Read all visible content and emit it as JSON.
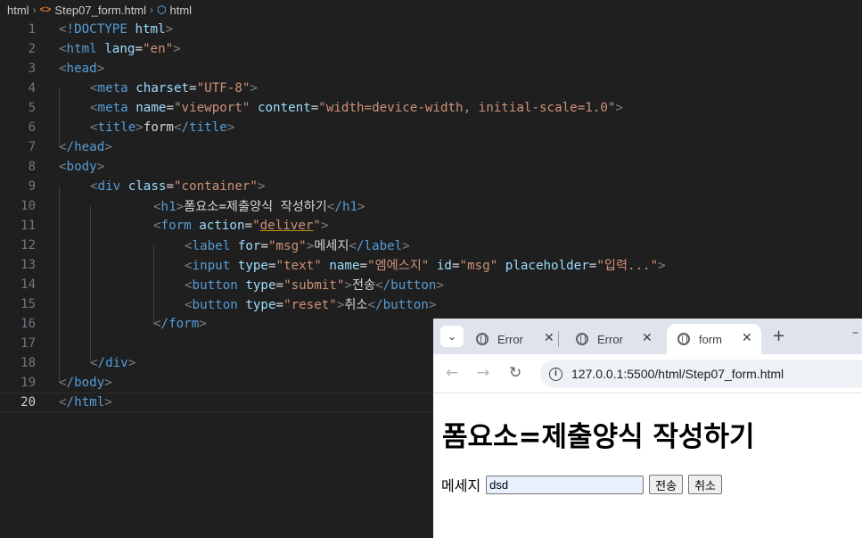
{
  "breadcrumb": {
    "root": "html",
    "file": "Step07_form.html",
    "element": "html"
  },
  "editor": {
    "current_line": 20,
    "lines": [
      {
        "n": "1"
      },
      {
        "n": "2"
      },
      {
        "n": "3"
      },
      {
        "n": "4"
      },
      {
        "n": "5"
      },
      {
        "n": "6"
      },
      {
        "n": "7"
      },
      {
        "n": "8"
      },
      {
        "n": "9"
      },
      {
        "n": "10"
      },
      {
        "n": "11"
      },
      {
        "n": "12"
      },
      {
        "n": "13"
      },
      {
        "n": "14"
      },
      {
        "n": "15"
      },
      {
        "n": "16"
      },
      {
        "n": "17"
      },
      {
        "n": "18"
      },
      {
        "n": "19"
      },
      {
        "n": "20"
      }
    ],
    "code": {
      "doctype_kw": "!DOCTYPE",
      "doctype_val": "html",
      "html_tag": "html",
      "lang_attr": "lang",
      "lang_val": "\"en\"",
      "head_tag": "head",
      "meta_tag": "meta",
      "charset_attr": "charset",
      "charset_val": "\"UTF-8\"",
      "name_attr": "name",
      "viewport_val": "\"viewport\"",
      "content_attr": "content",
      "content_val": "\"width=device-width, initial-scale=1.0\"",
      "title_tag": "title",
      "title_text": "form",
      "title_close": "/title",
      "head_close": "/head",
      "body_tag": "body",
      "div_tag": "div",
      "class_attr": "class",
      "class_val": "\"container\"",
      "h1_tag": "h1",
      "h1_text": "폼요소=제출양식 작성하기",
      "h1_close": "/h1",
      "form_tag": "form",
      "action_attr": "action",
      "action_q1": "\"",
      "action_val": "deliver",
      "action_q2": "\"",
      "label_tag": "label",
      "for_attr": "for",
      "for_val": "\"msg\"",
      "label_text": "메세지",
      "label_close": "/label",
      "input_tag": "input",
      "type_attr": "type",
      "text_val": "\"text\"",
      "input_name_val": "\"엠에스지\"",
      "id_attr": "id",
      "id_val": "\"msg\"",
      "placeholder_attr": "placeholder",
      "placeholder_val": "\"입력...\"",
      "button_tag": "button",
      "submit_val": "\"submit\"",
      "submit_text": "전송",
      "button_close": "/button",
      "reset_val": "\"reset\"",
      "reset_text": "취소",
      "form_close": "/form",
      "div_close": "/div",
      "body_close": "/body",
      "html_close": "/html"
    }
  },
  "browser": {
    "tabs": [
      {
        "title": "Error"
      },
      {
        "title": "Error"
      },
      {
        "title": "form"
      }
    ],
    "url": "127.0.0.1:5500/html/Step07_form.html",
    "page": {
      "heading": "폼요소=제출양식 작성하기",
      "label": "메세지",
      "input_value": "dsd",
      "input_placeholder": "입력...",
      "submit_label": "전송",
      "reset_label": "취소"
    }
  },
  "icons": {
    "breadcrumb_sep": "chevron-right-icon",
    "html_file": "html-file-icon",
    "element": "element-box-icon",
    "tab_globe": "globe-icon",
    "tab_close": "close-icon",
    "new_tab": "plus-icon",
    "back": "arrow-left-icon",
    "forward": "arrow-right-icon",
    "reload": "reload-icon",
    "site_info": "info-icon"
  }
}
